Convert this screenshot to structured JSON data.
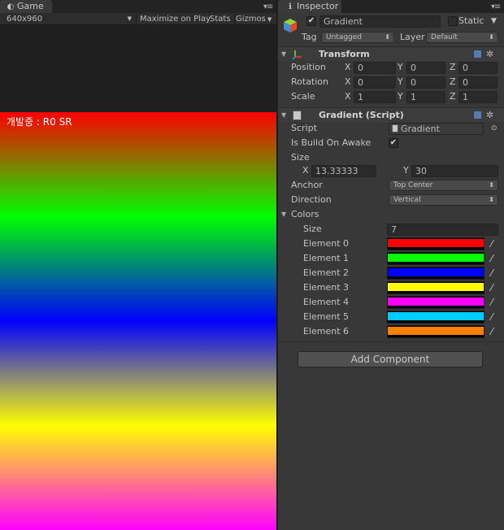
{
  "game": {
    "tab_label": "Game",
    "resolution": "640x960",
    "maximize_label": "Maximize on Play",
    "stats_label": "Stats",
    "gizmos_label": "Gizmos",
    "dev_label": "개발중 : R0 SR",
    "gradient_colors": [
      "#ff0000",
      "#00ff00",
      "#0000ff",
      "#ffff00",
      "#ff00ff"
    ]
  },
  "inspector": {
    "tab_label": "Inspector",
    "object": {
      "name": "Gradient",
      "active": true,
      "static_label": "Static",
      "static": false,
      "tag_label": "Tag",
      "tag_value": "Untagged",
      "layer_label": "Layer",
      "layer_value": "Default"
    },
    "transform": {
      "title": "Transform",
      "position_label": "Position",
      "rotation_label": "Rotation",
      "scale_label": "Scale",
      "axis_x": "X",
      "axis_y": "Y",
      "axis_z": "Z",
      "position": {
        "x": "0",
        "y": "0",
        "z": "0"
      },
      "rotation": {
        "x": "0",
        "y": "0",
        "z": "0"
      },
      "scale": {
        "x": "1",
        "y": "1",
        "z": "1"
      }
    },
    "gradient_script": {
      "title": "Gradient (Script)",
      "script_label": "Script",
      "script_value": "Gradient",
      "build_on_awake_label": "Is Build On Awake",
      "build_on_awake": true,
      "size_label": "Size",
      "size_x": "13.33333",
      "size_y": "30",
      "anchor_label": "Anchor",
      "anchor_value": "Top Center",
      "direction_label": "Direction",
      "direction_value": "Vertical",
      "colors_label": "Colors",
      "colors_size_label": "Size",
      "colors_size": "7",
      "elements": [
        {
          "label": "Element 0",
          "color": "#ff0000"
        },
        {
          "label": "Element 1",
          "color": "#00ff00"
        },
        {
          "label": "Element 2",
          "color": "#0000ff"
        },
        {
          "label": "Element 3",
          "color": "#ffff00"
        },
        {
          "label": "Element 4",
          "color": "#ff00ff"
        },
        {
          "label": "Element 5",
          "color": "#00ccff"
        },
        {
          "label": "Element 6",
          "color": "#ff8000"
        }
      ]
    },
    "add_component_label": "Add Component"
  }
}
